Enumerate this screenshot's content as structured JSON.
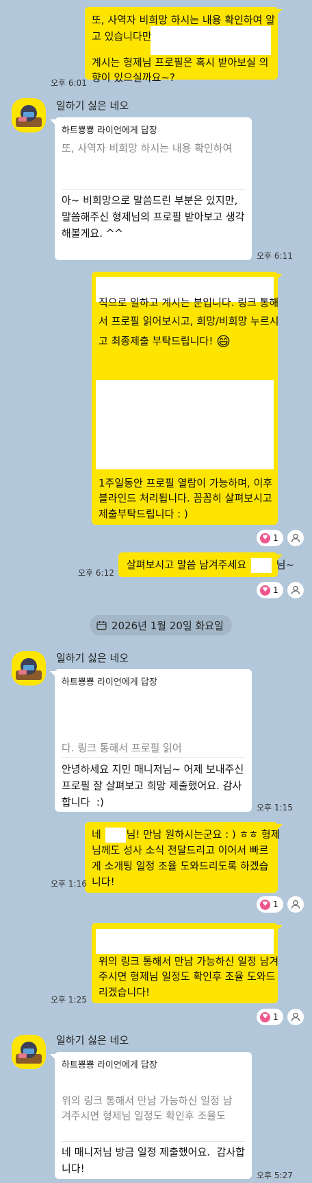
{
  "messages": {
    "m1": {
      "line1": "또, 사역자 비희망 하시는 내용 확인하여 알",
      "line2": "고 있습니다만",
      "line3": "계시는 형제님 프로필은 혹시 받아보실 의",
      "line4": "향이 있으실까요~?",
      "time": "오후 6:01"
    },
    "m2": {
      "sender": "일하기 싫은 네오",
      "reply_to": "하트뿅뿅 라이언에게 답장",
      "quote": "또, 사역자 비희망 하시는 내용 확인하여",
      "text": "아~ 비희망으로 말씀드린 부분은 있지만, 말씀해주신 형제님의 프로필 받아보고 생각해볼게요. ^^",
      "time": "오후 6:11"
    },
    "m3": {
      "line1": "직으로 일하고 계시는 분입니다. 링크 통해",
      "line2": "서 프로필 읽어보시고, 희망/비희망 누르시",
      "line3": "고 최종제출 부탁드립니다!",
      "emoji": "😄",
      "line4": "1주일동안 프로필 열람이 가능하며, 이후",
      "line5": "블라인드 처리됩니다. 꼼꼼히 살펴보시고",
      "line6": "제출부탁드립니다 : )",
      "reaction_count": "1"
    },
    "m4": {
      "text_a": "살펴보시고 말씀 남겨주세요",
      "text_b": "님~",
      "time": "오후 6:12",
      "reaction_count": "1"
    },
    "date_divider": "2026년 1월 20일 화요일",
    "m5": {
      "sender": "일하기 싫은 네오",
      "reply_to": "하트뿅뿅 라이언에게 답장",
      "quote": "다. 링크 통해서 프로필 읽어",
      "text": "안녕하세요 지민 매니저님~ 어제 보내주신 프로필 잘 살펴보고 희망 제출했어요. 감사합니다  :)",
      "time": "오후 1:15"
    },
    "m6": {
      "prefix": "네",
      "line1_rest": "님! 만남 원하시는군요 : ) ㅎㅎ 형제",
      "line2": "님께도 성사 소식 전달드리고 이어서 빠르",
      "line3": "게 소개팅 일정 조율 도와드리도록 하겠습",
      "line4": "니다!",
      "time": "오후 1:16",
      "reaction_count": "1"
    },
    "m7": {
      "line1": "위의 링크 통해서 만남 가능하신 일정 남겨",
      "line2": "주시면 형제님 일정도 확인후 조율 도와드",
      "line3": "리겠습니다!",
      "time": "오후 1:25",
      "reaction_count": "1"
    },
    "m8": {
      "sender": "일하기 싫은 네오",
      "reply_to": "하트뿅뿅 라이언에게 답장",
      "quote": "위의 링크 통해서 만남 가능하신 일정 남겨주시면 형제님 일정도 확인후 조율도",
      "text": "네 매니저님 방금 일정 제출했어요.  감사합니다!",
      "time": "오후 5:27"
    }
  },
  "icons": {
    "heart": "heart-icon",
    "person": "person-icon",
    "calendar": "calendar-icon",
    "avatar": "bear-avatar-icon"
  },
  "colors": {
    "background": "#b2c7d9",
    "my_bubble": "#fee500",
    "their_bubble": "#ffffff",
    "reaction_heart": "#f0578e"
  }
}
